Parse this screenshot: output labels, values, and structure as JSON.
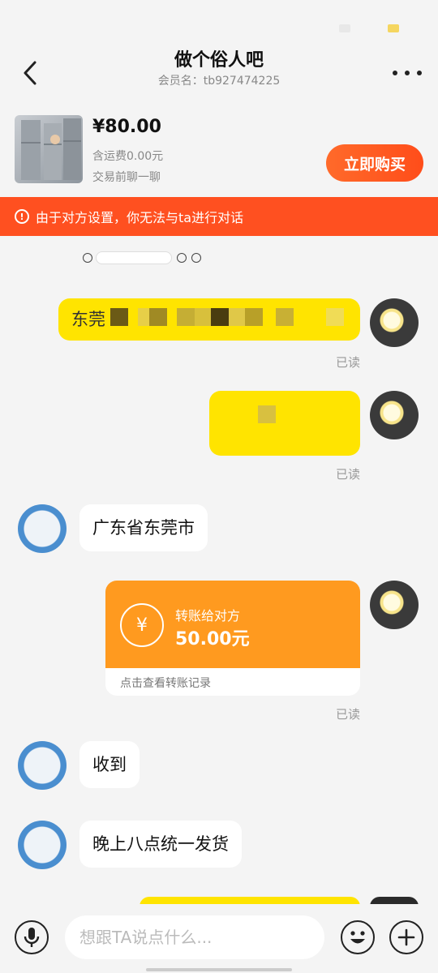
{
  "header": {
    "title": "做个俗人吧",
    "member_label": "会员名：tb927474225"
  },
  "product": {
    "price": "¥80.00",
    "shipping": "含运费0.00元",
    "note": "交易前聊一聊",
    "buy_label": "立即购买"
  },
  "notice": {
    "text": "由于对方设置，你无法与ta进行对话",
    "icon": "warning-circle-icon"
  },
  "messages": [
    {
      "from": "me",
      "text": "东莞",
      "read": "已读"
    },
    {
      "from": "me",
      "text": "",
      "read": "已读"
    },
    {
      "from": "other",
      "text": "广东省东莞市"
    },
    {
      "from": "me",
      "type": "transfer",
      "label": "转账给对方",
      "amount": "50.00元",
      "link": "点击查看转账记录",
      "read": "已读"
    },
    {
      "from": "other",
      "text": "收到"
    },
    {
      "from": "other",
      "text": "晚上八点统一发货"
    }
  ],
  "input": {
    "placeholder": "想跟TA说点什么..."
  },
  "icons": {
    "back": "chevron-left-icon",
    "more": "more-dots-icon",
    "voice": "microphone-icon",
    "emoji": "smiley-icon",
    "plus": "plus-icon",
    "yuan": "yuan-refresh-icon"
  },
  "colors": {
    "accent": "#ff5020",
    "bubble_me": "#ffe400",
    "transfer": "#ff9a1f"
  }
}
